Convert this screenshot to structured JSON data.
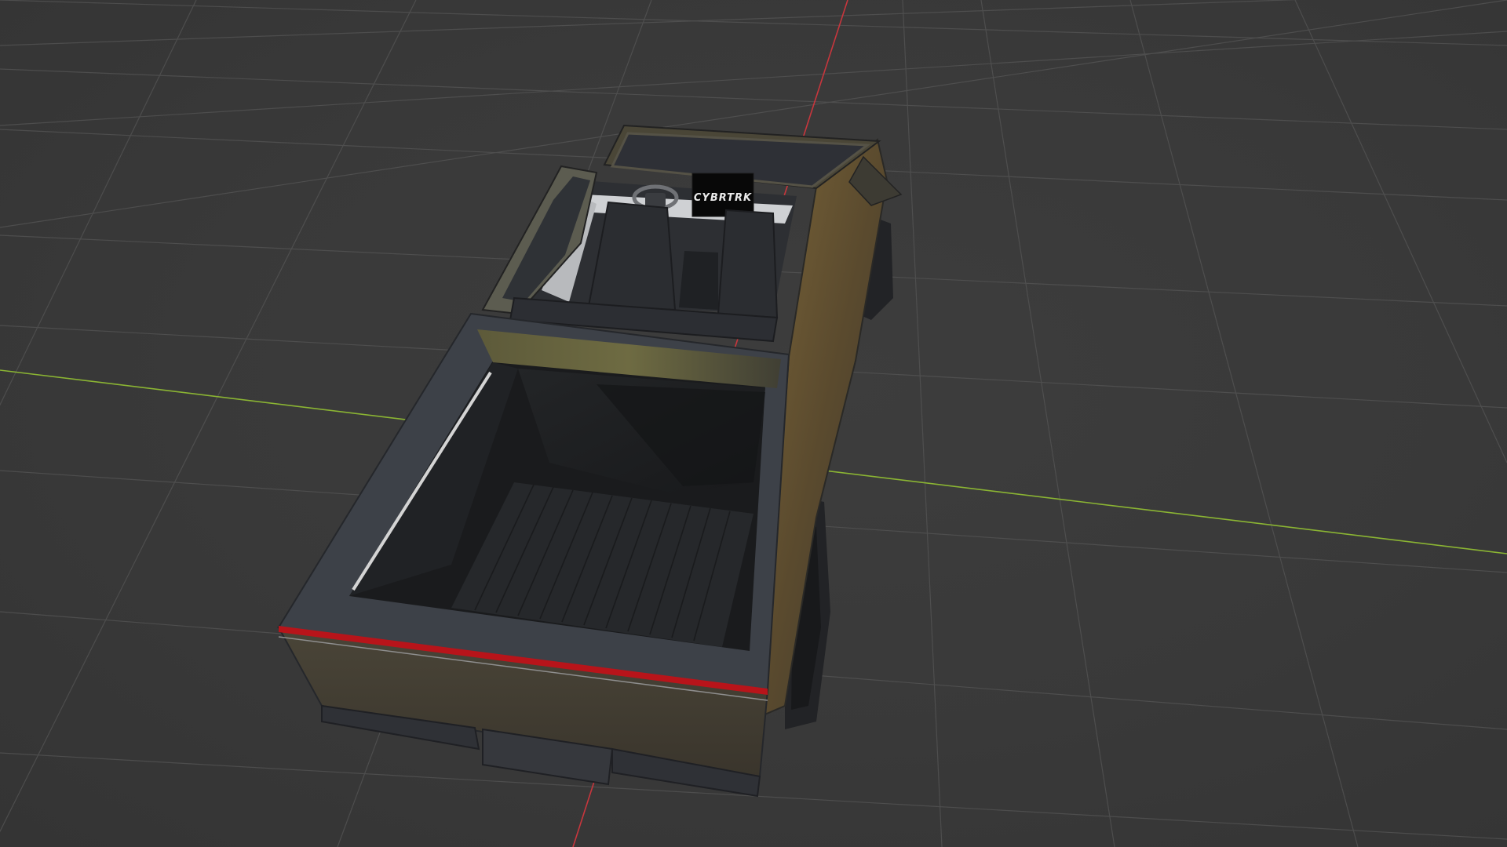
{
  "viewport": {
    "background_color": "#3a3a3a",
    "grid_color": "#555555",
    "x_axis_color": "#c8363d",
    "y_axis_color": "#8bb533"
  },
  "model": {
    "body_color": "#3d4148",
    "panel_color": "#6b5530",
    "tail_light_color": "#b8141a",
    "bed_color": "#1d1f22",
    "screen_text": "CYBRTRK"
  }
}
